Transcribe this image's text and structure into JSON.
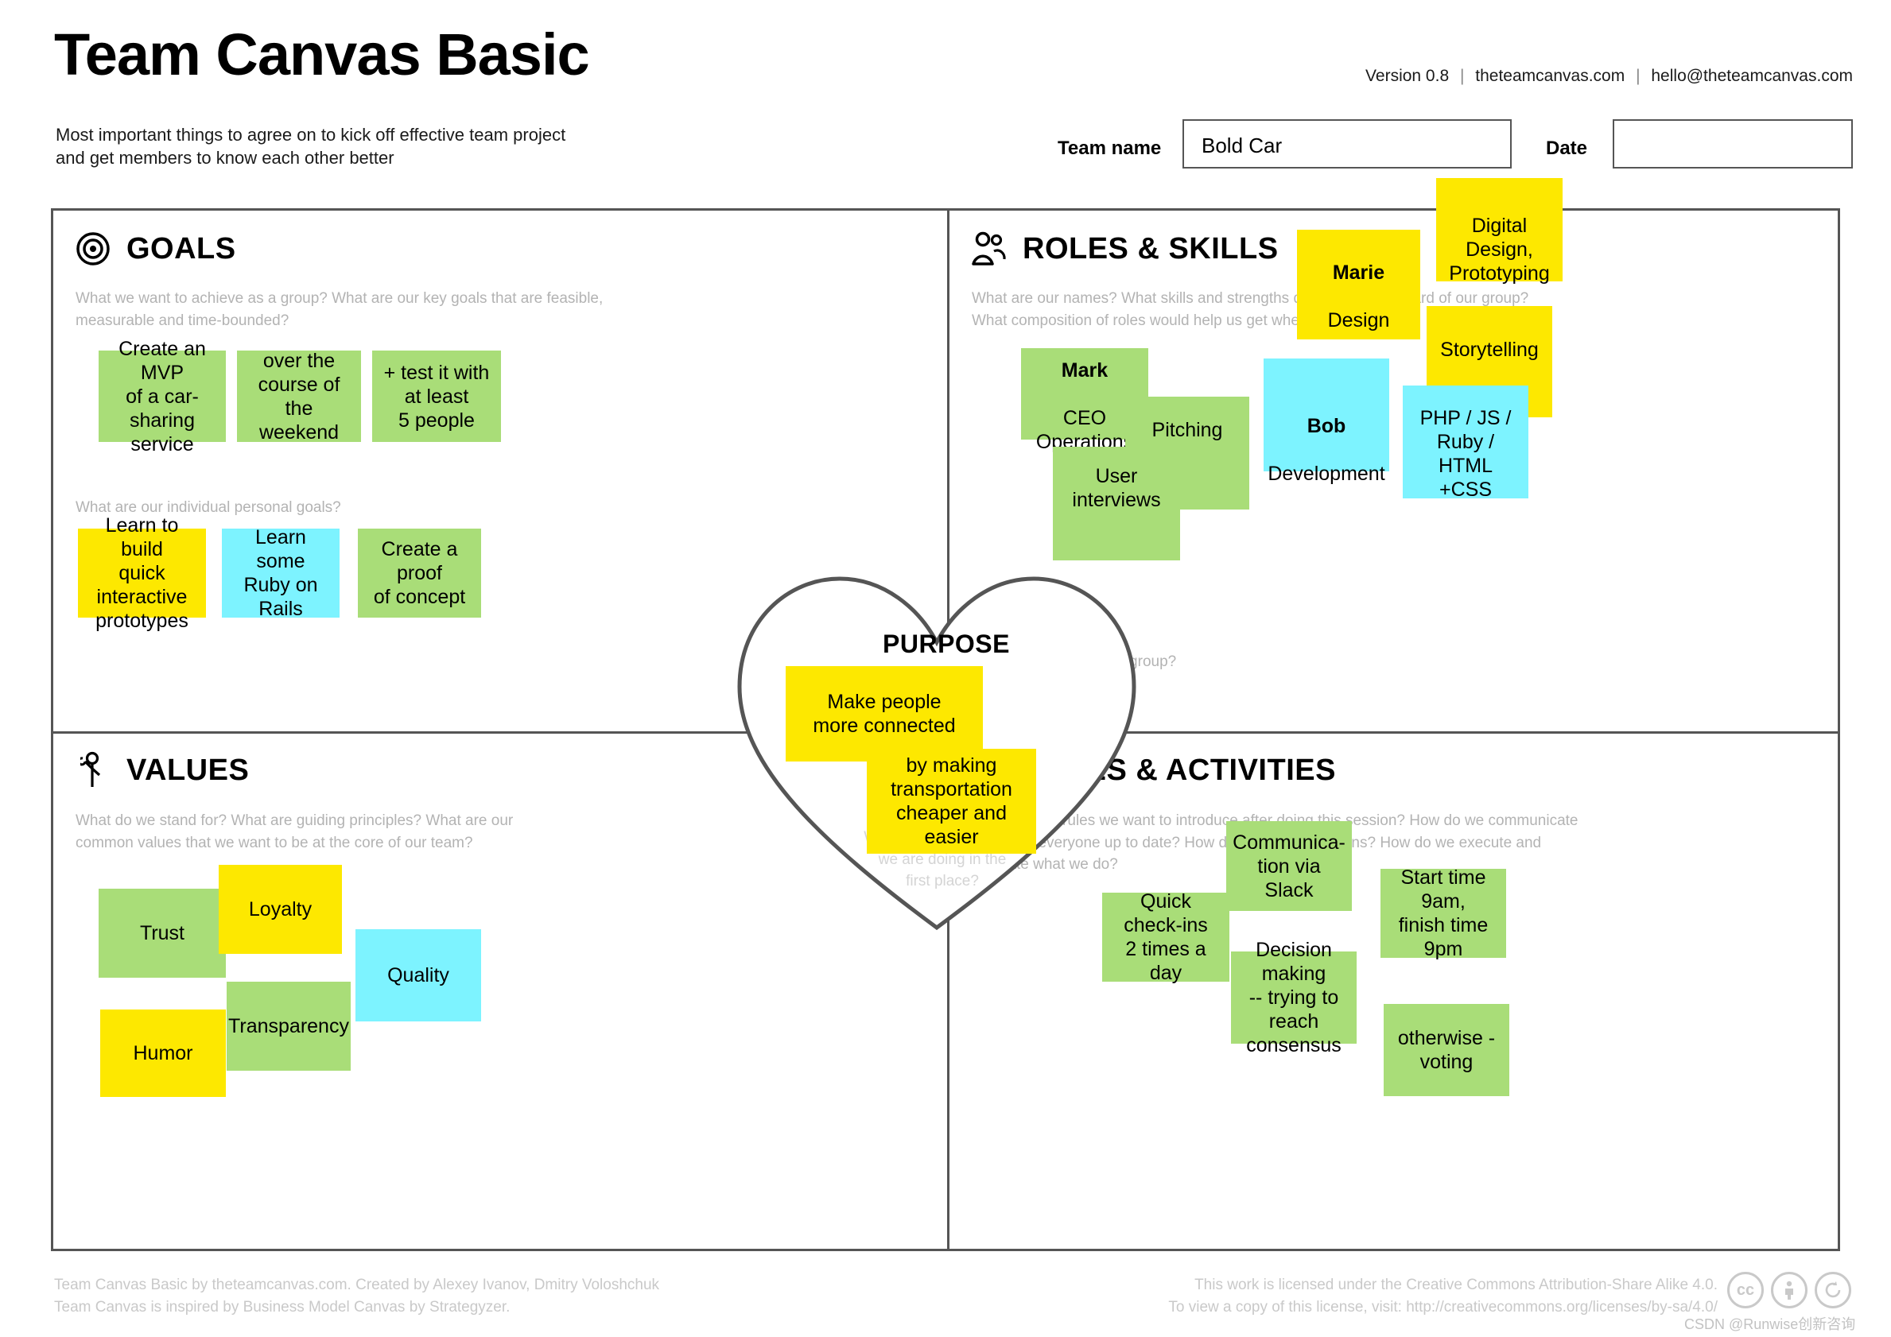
{
  "header": {
    "title": "Team Canvas Basic",
    "subtitle": "Most important things to agree on to kick off effective team project\nand get members to know each other better",
    "version": "Version 0.8",
    "website": "theteamcanvas.com",
    "email": "hello@theteamcanvas.com",
    "team_name_label": "Team name",
    "team_name_value": "Bold Car",
    "date_label": "Date",
    "date_value": ""
  },
  "colors": {
    "green": "#a9dd78",
    "yellow": "#fde800",
    "cyan": "#7df3ff",
    "border": "#555555",
    "muted": "#b3b3b3"
  },
  "sections": {
    "goals": {
      "title": "GOALS",
      "icon": "target-icon",
      "description": "What we want to achieve as a group? What are our key goals that are feasible,\nmeasurable and time-bounded?",
      "sub_question": "What are our individual personal goals?",
      "notes": [
        {
          "text": "Create an MVP\nof a car-sharing\nservice",
          "color": "green"
        },
        {
          "text": "over the\ncourse of\nthe weekend",
          "color": "green"
        },
        {
          "text": "+ test it with\nat least\n5 people",
          "color": "green"
        },
        {
          "text": "Learn to build\nquick interactive\nprototypes",
          "color": "yellow"
        },
        {
          "text": "Learn some\nRuby on Rails",
          "color": "cyan"
        },
        {
          "text": "Create a proof\nof concept",
          "color": "green"
        }
      ]
    },
    "roles": {
      "title": "ROLES & SKILLS",
      "icon": "people-icon",
      "description": "What are our names? What skills and strengths do we have on board of our group?\nWhat composition of roles would help us get where we want to be?",
      "sub_question": "What are we called as a group?",
      "notes": [
        {
          "name": "Mark",
          "text": "CEO\nOperations",
          "color": "green"
        },
        {
          "text": "Pitching",
          "color": "green"
        },
        {
          "text": "User interviews",
          "color": "green"
        },
        {
          "text": "Digital Design,\nPrototyping",
          "color": "yellow"
        },
        {
          "name": "Marie",
          "text": "Design",
          "color": "yellow"
        },
        {
          "text": "Storytelling",
          "color": "yellow"
        },
        {
          "name": "Bob",
          "text": "Development",
          "color": "cyan"
        },
        {
          "text": "PHP / JS /\nRuby / HTML\n+CSS",
          "color": "cyan"
        }
      ]
    },
    "values": {
      "title": "VALUES",
      "icon": "person-raised-hand-icon",
      "description": "What do we stand for? What are guiding principles? What are our\ncommon values that we want to be at the core of our team?",
      "notes": [
        {
          "text": "Trust",
          "color": "green"
        },
        {
          "text": "Loyalty",
          "color": "yellow"
        },
        {
          "text": "Quality",
          "color": "cyan"
        },
        {
          "text": "Humor",
          "color": "yellow"
        },
        {
          "text": "Transparency",
          "color": "green"
        }
      ]
    },
    "rules": {
      "title": "RULES & ACTIVITIES",
      "icon": "checklist-icon",
      "description": "What are the rules we want to introduce after doing this session? How do we communicate\nand keep everyone up to date? How do we make decisions? How do we execute and\nevaluate what we do?",
      "notes": [
        {
          "text": "Quick check-ins\n2 times a day",
          "color": "green"
        },
        {
          "text": "Communica-\ntion via Slack",
          "color": "green"
        },
        {
          "text": "Start time 9am,\nfinish time 9pm",
          "color": "green"
        },
        {
          "text": "Decision making\n-- trying to reach\nconsensus",
          "color": "green"
        },
        {
          "text": "otherwise -\nvoting",
          "color": "green"
        }
      ]
    },
    "purpose": {
      "title": "PURPOSE",
      "icon": "heart-icon",
      "description": "Why we are doing what\nwe are doing in the\nfirst place?",
      "notes": [
        {
          "text": "Make people\nmore connected",
          "color": "yellow"
        },
        {
          "text": "by making\ntransportation\ncheaper and\neasier",
          "color": "yellow"
        }
      ]
    }
  },
  "footer": {
    "left": "Team Canvas Basic by theteamcanvas.com. Created by Alexey Ivanov, Dmitry Voloshchuk\nTeam Canvas is inspired by Business Model Canvas by Strategyzer.",
    "right": "This work is licensed under the Creative Commons Attribution-Share Alike 4.0.\nTo view a copy of this license, visit: http://creativecommons.org/licenses/by-sa/4.0/",
    "cc_badges": [
      "cc",
      "by",
      "sa"
    ],
    "watermark": "CSDN @Runwise创新咨询"
  }
}
